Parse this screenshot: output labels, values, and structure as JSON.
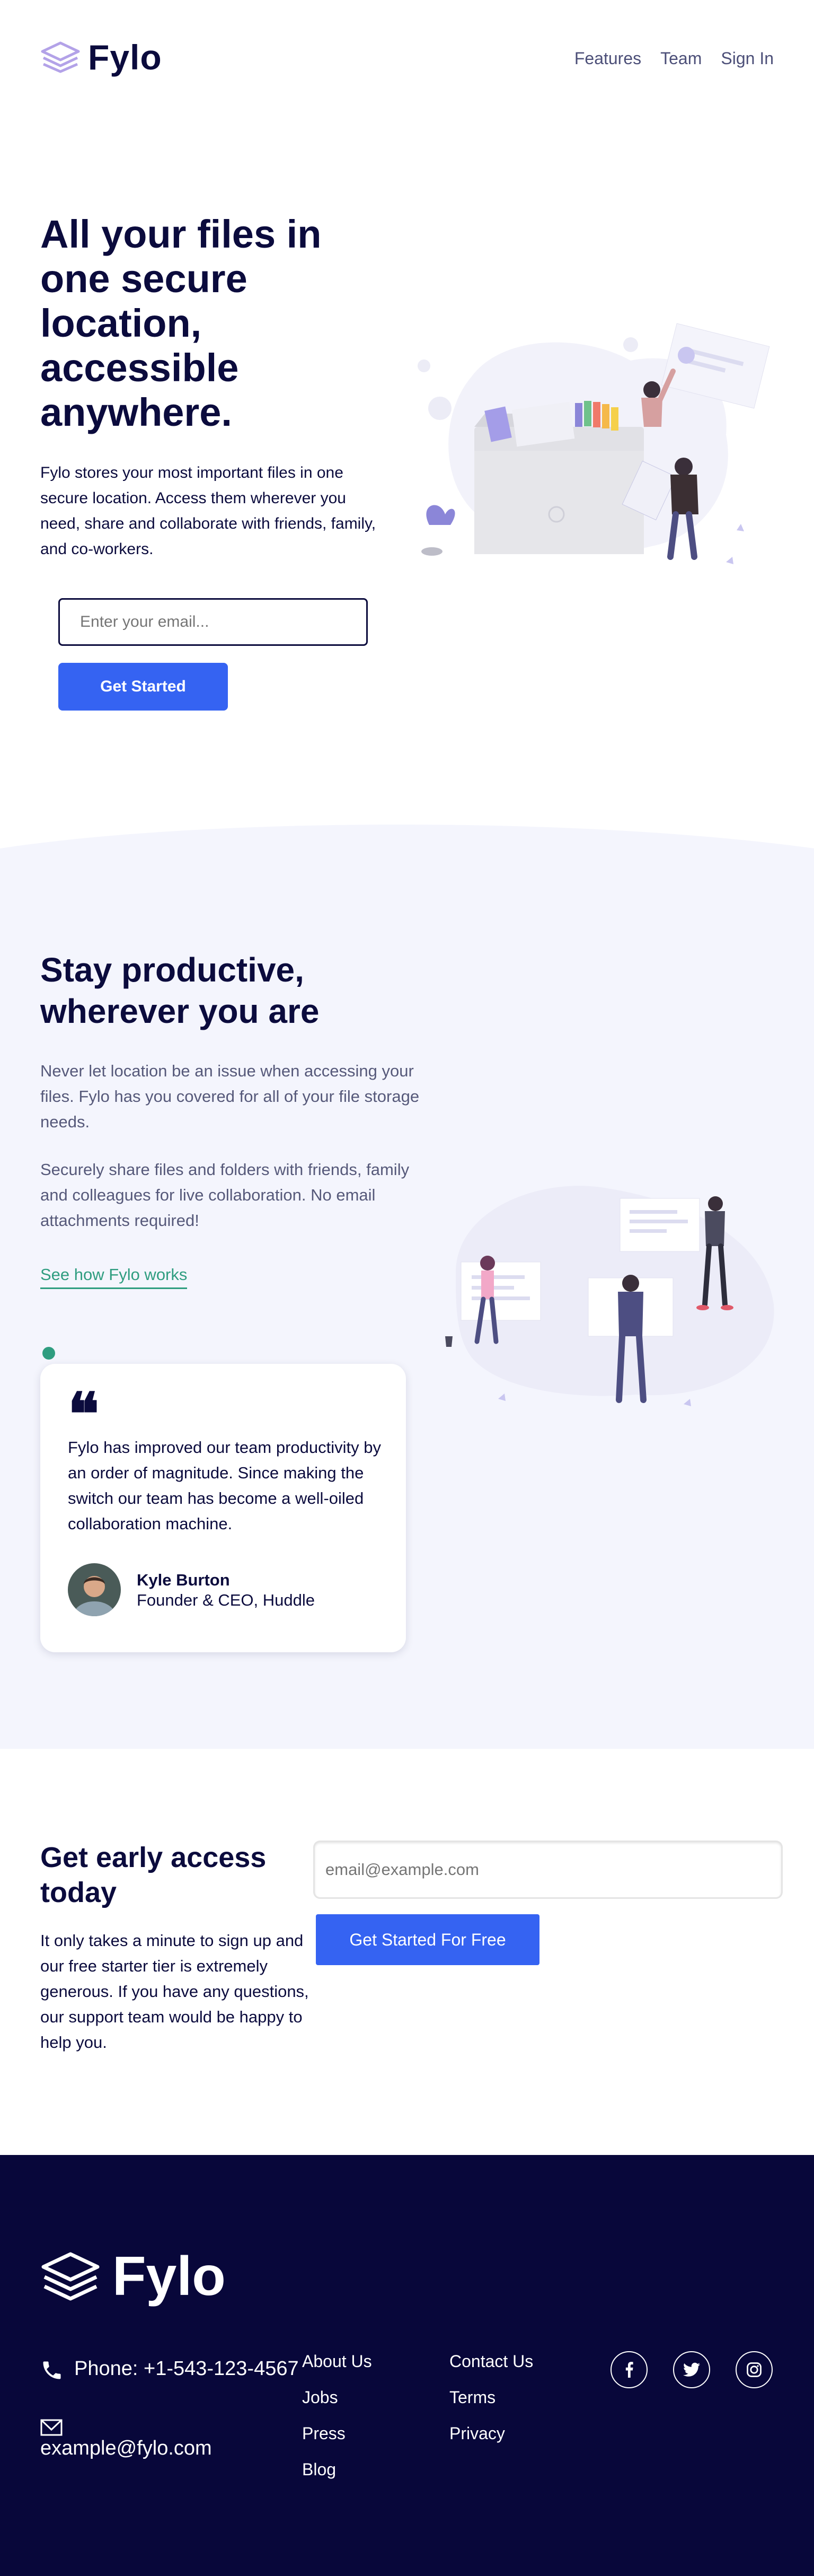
{
  "brand": {
    "name": "Fylo",
    "primary_color": "#3563f2",
    "dark_color": "#0b0b3d",
    "accent_green": "#2f9d80",
    "section_bg": "#f4f5fd",
    "footer_bg": "#08073a"
  },
  "nav": {
    "items": [
      {
        "label": "Features"
      },
      {
        "label": "Team"
      },
      {
        "label": "Sign In"
      }
    ]
  },
  "hero": {
    "title": "All your files in one secure location, accessible anywhere.",
    "text": "Fylo stores your most important files in one secure location. Access them wherever you need, share and collaborate with friends, family, and co-workers.",
    "email_placeholder": "Enter your email...",
    "button_label": "Get Started"
  },
  "productive": {
    "title": "Stay productive, wherever you are",
    "paragraph1": "Never let location be an issue when accessing your files. Fylo has you covered for all of your file storage needs.",
    "paragraph2": "Securely share files and folders with friends, family and colleagues for live collaboration. No email attachments required!",
    "link_label": "See how Fylo works"
  },
  "testimonial": {
    "quote_mark": "❝",
    "quote": "Fylo has improved our team productivity by an order of magnitude. Since making the switch our team has become a well-oiled collaboration machine.",
    "author_name": "Kyle Burton",
    "author_role": "Founder & CEO, Huddle"
  },
  "early_access": {
    "title": "Get early access today",
    "text": "It only takes a minute to sign up and our free starter tier is extremely generous. If you have any questions, our support team would be happy to help you.",
    "email_placeholder": "email@example.com",
    "button_label": "Get Started For Free"
  },
  "footer": {
    "logo_text": "Fylo",
    "phone": "Phone: +1-543-123-4567",
    "email": "example@fylo.com",
    "column1": [
      {
        "label": "About Us"
      },
      {
        "label": "Jobs"
      },
      {
        "label": "Press"
      },
      {
        "label": "Blog"
      }
    ],
    "column2": [
      {
        "label": "Contact Us"
      },
      {
        "label": "Terms"
      },
      {
        "label": "Privacy"
      }
    ],
    "socials": [
      {
        "icon": "facebook-icon"
      },
      {
        "icon": "twitter-icon"
      },
      {
        "icon": "instagram-icon"
      }
    ]
  }
}
